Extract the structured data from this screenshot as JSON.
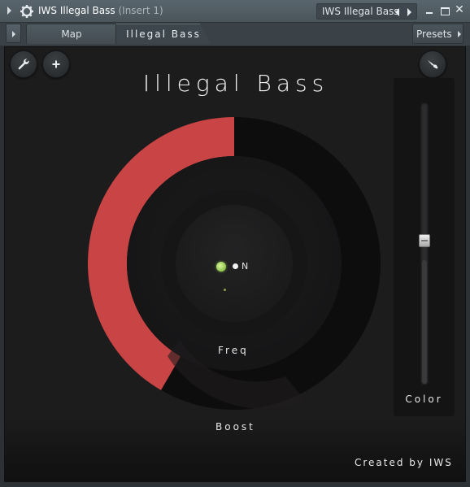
{
  "window": {
    "title": "IWS Illegal Bass",
    "subtitle": "(Insert 1)",
    "preset_name": "IWS Illegal Bass",
    "close_glyph": "✕"
  },
  "tabs": [
    {
      "label": "Map",
      "active": false
    },
    {
      "label": "Illegal Bass",
      "active": true
    }
  ],
  "presets_label": "Presets",
  "plugin": {
    "title": "Illegal Bass",
    "on_label": "N",
    "freq_label": "Freq",
    "boost_label": "Boost",
    "credit": "Created by IWS",
    "boost_level": 0.5,
    "accent_color": "#c94444",
    "led_color": "#8bc34a"
  },
  "color_slider": {
    "label": "Color",
    "value": 0.5
  },
  "icons": {
    "settings": "wrench-icon",
    "add": "plus-icon",
    "brush": "brush-icon"
  }
}
